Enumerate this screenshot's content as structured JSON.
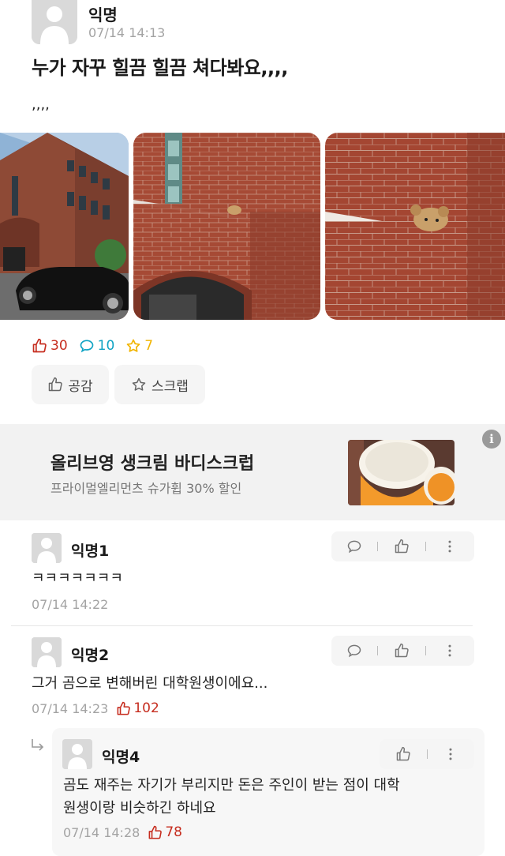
{
  "post": {
    "author": "익명",
    "time": "07/14 14:13",
    "title": "누가 자꾸 힐끔 힐끔 쳐다봐요,,,,",
    "body": ",,,,",
    "photos": [
      "building-with-car-photo",
      "brick-wall-with-bear-photo",
      "brick-ledge-bear-closeup-photo"
    ],
    "stats": {
      "likes": "30",
      "comments": "10",
      "scraps": "7"
    },
    "actions": {
      "like_label": "공감",
      "scrap_label": "스크랩"
    }
  },
  "ad": {
    "title": "올리브영 생크림 바디스크럽",
    "subtitle": "프라이멀엘리먼츠 슈가휩 30% 할인",
    "info_glyph": "i"
  },
  "comments": [
    {
      "author": "익명1",
      "text": "ㅋㅋㅋㅋㅋㅋㅋ",
      "time": "07/14 14:22",
      "likes": ""
    },
    {
      "author": "익명2",
      "text": "그거 곰으로 변해버린 대학원생이에요...",
      "time": "07/14 14:23",
      "likes": "102"
    }
  ],
  "reply": {
    "author": "익명4",
    "text_line1": "곰도 재주는 자기가 부리지만 돈은 주인이 받는 점이 대학",
    "text_line2": "원생이랑 비슷하긴 하네요",
    "time": "07/14 14:28",
    "likes": "78"
  },
  "colors": {
    "like": "#c62d1f",
    "comment": "#0fa3c4",
    "scrap": "#f1b400",
    "meta": "#a3a3a3",
    "ad_bg": "#f2f2f2"
  },
  "icons": [
    "thumbs-up-icon",
    "speech-bubble-icon",
    "star-icon",
    "more-vertical-icon",
    "reply-arrow-icon",
    "info-icon"
  ]
}
